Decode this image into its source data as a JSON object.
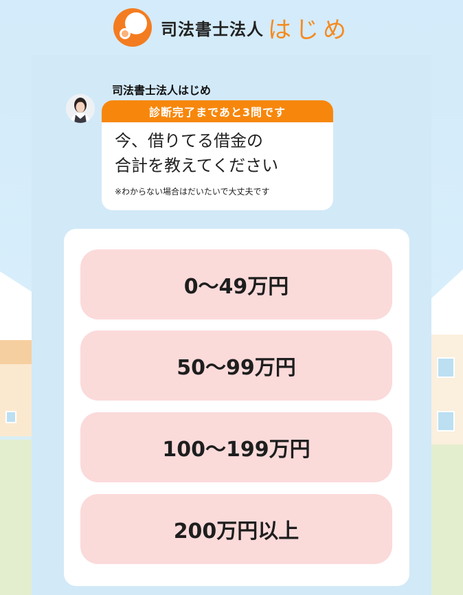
{
  "brand": {
    "name": "司法書士法人",
    "name_hiragana": "はじめ",
    "accent_color": "#f58a1f"
  },
  "chat": {
    "sender": "司法書士法人はじめ",
    "progress_banner": "診断完了まであと3問です",
    "question": "今、借りてる借金の\n合計を教えてください",
    "note": "※わからない場合はだいたいで大丈夫です"
  },
  "options": [
    {
      "label": "0〜49万円"
    },
    {
      "label": "50〜99万円"
    },
    {
      "label": "100〜199万円"
    },
    {
      "label": "200万円以上"
    }
  ],
  "colors": {
    "banner": "#f7870c",
    "option_bg": "#fbdada",
    "panel_bg": "#d2e9f8"
  }
}
